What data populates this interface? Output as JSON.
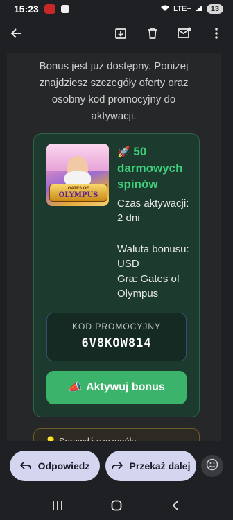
{
  "status": {
    "time": "15:23",
    "network": "LTE+",
    "battery": "13"
  },
  "toolbar": {
    "icons": [
      "back-arrow",
      "archive",
      "delete",
      "mark-unread",
      "more"
    ]
  },
  "email": {
    "intro": "Bonus jest już dostępny. Poniżej znajdziesz szczegóły oferty oraz osobny kod promocyjny do aktywacji.",
    "offer": {
      "rocket": "🚀",
      "title": "50 darmowych spinów",
      "game_logo_top": "GATES OF",
      "game_logo_main": "OLYMPUS",
      "activation": "Czas aktywacji: 2 dni",
      "currency": "Waluta bonusu: USD",
      "game": "Gra: Gates of Olympus",
      "promo_label": "KOD PROMOCYJNY",
      "promo_code": "6V8KOW814",
      "activate_icon": "📣",
      "activate_label": "Aktywuj bonus"
    },
    "next_card_text": "💡 Sprawdź szczegóły..."
  },
  "actions": {
    "reply": "Odpowiedz",
    "forward": "Przekaż dalej"
  },
  "colors": {
    "accent_green": "#3bb36b",
    "card_bg": "#1d3a2e",
    "button_bg": "#d3d6ee"
  }
}
